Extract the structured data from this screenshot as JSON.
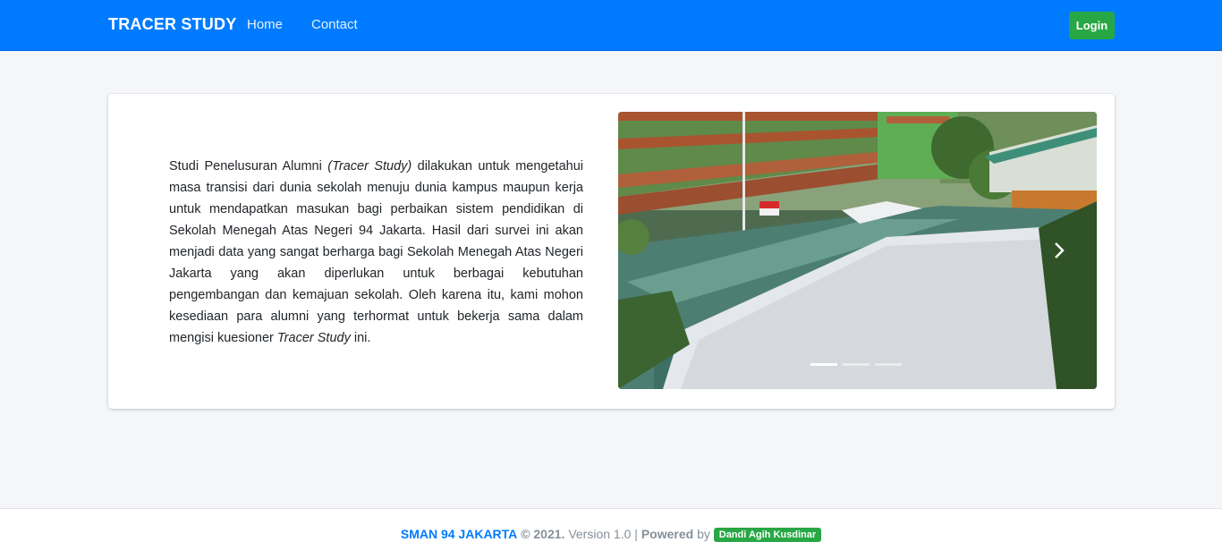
{
  "navbar": {
    "brand": "TRACER STUDY",
    "links": [
      "Home",
      "Contact"
    ],
    "login_label": "Login",
    "color": "#007bff"
  },
  "intro": {
    "part1": "Studi Penelusuran Alumni ",
    "em1": "(Tracer Study)",
    "part2": " dilakukan untuk mengetahui masa transisi dari dunia sekolah menuju dunia kampus maupun kerja untuk mendapatkan masukan bagi perbaikan sistem pendidikan di Sekolah Menegah Atas Negeri 94 Jakarta. Hasil dari survei ini akan menjadi data yang sangat berharga bagi Sekolah Menegah Atas Negeri Jakarta yang akan diperlukan untuk berbagai kebutuhan pengembangan dan kemajuan sekolah. Oleh karena itu, kami mohon kesediaan para alumni yang terhormat untuk bekerja sama dalam mengisi kuesioner ",
    "em2": "Tracer Study",
    "part3": " ini."
  },
  "carousel": {
    "slide_count": 3,
    "active_index": 0,
    "next_icon": "chevron-right-icon"
  },
  "footer": {
    "school": "SMAN 94 JAKARTA",
    "copyright": "© 2021.",
    "version": "Version 1.0",
    "separator": "|",
    "powered": "Powered",
    "by": "by",
    "author": "Dandi Agih Kusdinar",
    "author_color": "#28a745"
  }
}
